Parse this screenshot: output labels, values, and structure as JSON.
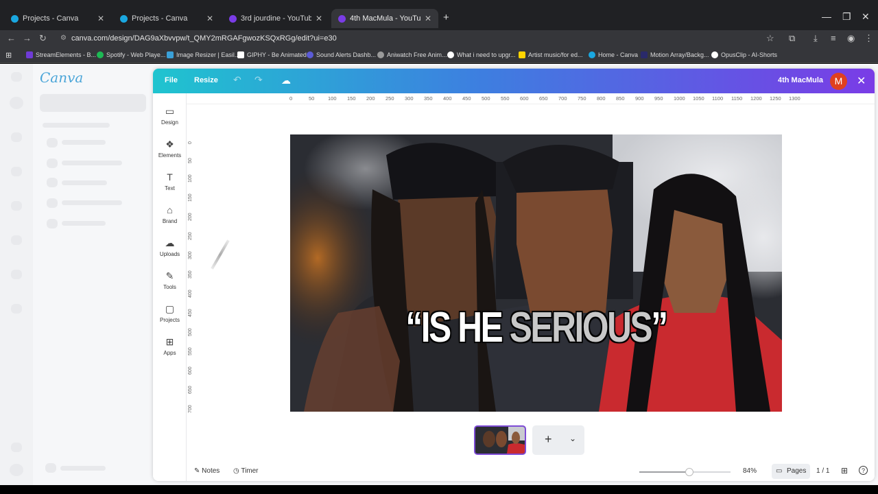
{
  "browser": {
    "tabs": [
      {
        "title": "Projects - Canva",
        "fav_color": "#1aa7e0"
      },
      {
        "title": "Projects - Canva",
        "fav_color": "#1aa7e0"
      },
      {
        "title": "3rd jourdine - YouTube Thumb",
        "fav_color": "#7a3ce6"
      },
      {
        "title": "4th MacMula - YouTube Thumb",
        "fav_color": "#7a3ce6"
      }
    ],
    "tab_close": "✕",
    "new_tab": "+",
    "win_min": "—",
    "win_max": "❐",
    "win_close": "✕",
    "url": "canva.com/design/DAG9aXbvvpw/t_QMY2mRGAFgwozKSQxRGg/edit?ui=e30",
    "bookmarks": [
      {
        "label": "StreamElements - B...",
        "color": "#6f3bd6"
      },
      {
        "label": "Spotify - Web Playe...",
        "color": "#1db954"
      },
      {
        "label": "Image Resizer | Easil...",
        "color": "#3aa0d8"
      },
      {
        "label": "GIPHY - Be Animated",
        "color": "#ffffff"
      },
      {
        "label": "Sound Alerts Dashb...",
        "color": "#5b5bd6"
      },
      {
        "label": "Aniwatch Free Anim...",
        "color": "#9a9a9a"
      },
      {
        "label": "What i need to upgr...",
        "color": "#ffffff"
      },
      {
        "label": "Artist music/for ed...",
        "color": "#ffd400"
      },
      {
        "label": "Home - Canva",
        "color": "#1aa7e0"
      },
      {
        "label": "Motion Array/Backg...",
        "color": "#2a2a6a"
      },
      {
        "label": "OpusClip - AI-Shorts",
        "color": "#ffffff"
      }
    ]
  },
  "canva": {
    "logo": "Canva",
    "toolbar": {
      "file": "File",
      "resize": "Resize",
      "undo": "↶",
      "redo": "↷",
      "cloud": "☁",
      "design_title": "4th MacMula",
      "avatar_letter": "M",
      "close": "✕"
    },
    "rail": [
      {
        "label": "Design",
        "icon": "▭"
      },
      {
        "label": "Elements",
        "icon": "❖"
      },
      {
        "label": "Text",
        "icon": "T"
      },
      {
        "label": "Brand",
        "icon": "⌂"
      },
      {
        "label": "Uploads",
        "icon": "☁"
      },
      {
        "label": "Tools",
        "icon": "✎"
      },
      {
        "label": "Projects",
        "icon": "▢"
      },
      {
        "label": "Apps",
        "icon": "⊞"
      }
    ],
    "ruler_h": [
      "0",
      "50",
      "100",
      "150",
      "200",
      "250",
      "300",
      "350",
      "400",
      "450",
      "500",
      "550",
      "600",
      "650",
      "700",
      "750",
      "800",
      "850",
      "900",
      "950",
      "1000",
      "1050",
      "1100",
      "1150",
      "1200",
      "1250",
      "1300"
    ],
    "ruler_v": [
      "0",
      "50",
      "100",
      "150",
      "200",
      "250",
      "300",
      "350",
      "400",
      "450",
      "500",
      "550",
      "600",
      "650",
      "700"
    ],
    "thumbnail_text": {
      "part1": "“IS HE ",
      "part2": "SERIOUS",
      "part3": "”"
    },
    "page_add": "+",
    "page_chevron": "⌄",
    "footer": {
      "notes": "Notes",
      "timer": "Timer",
      "zoom": "84%",
      "zoom_level": 0.55,
      "pages": "Pages",
      "page_count": "1 / 1",
      "grid": "⊞",
      "help": "?"
    }
  }
}
